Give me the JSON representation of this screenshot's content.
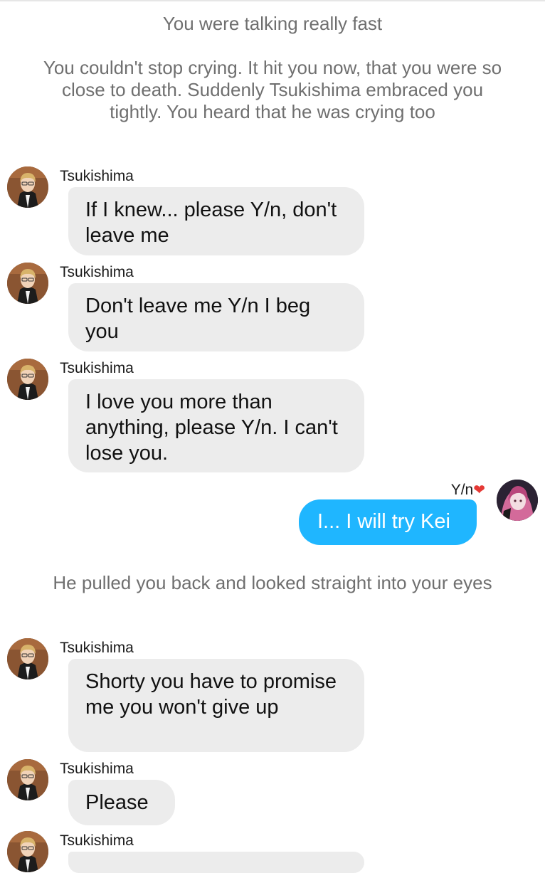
{
  "narration": [
    "You were talking really fast",
    "You couldn't stop crying. It hit you now, that you were so close to death. Suddenly Tsukishima embraced you tightly. You heard that he was crying too",
    "He pulled you back and looked straight into your eyes"
  ],
  "participants": {
    "other": {
      "name": "Tsukishima",
      "avatar_icon": "tsukishima-avatar-icon"
    },
    "me": {
      "name": "Y/n",
      "suffix_emoji": "❤",
      "avatar_icon": "user-avatar-icon"
    }
  },
  "messages": [
    {
      "sender": "Tsukishima",
      "text": "If I knew... please Y/n, don't leave me"
    },
    {
      "sender": "Tsukishima",
      "text": "Don't leave me Y/n I beg you"
    },
    {
      "sender": "Tsukishima",
      "text": "I love you more than anything, please Y/n. I can't lose you."
    },
    {
      "sender": "Y/n",
      "text": "I... I will try Kei"
    },
    {
      "sender": "Tsukishima",
      "text": "Shorty you have to promise me you won't give up"
    },
    {
      "sender": "Tsukishima",
      "text": "Please"
    },
    {
      "sender": "Tsukishima",
      "text": ""
    }
  ],
  "colors": {
    "incoming_bubble": "#ececec",
    "outgoing_bubble": "#1fb6ff",
    "narration_text": "#6f6f6f",
    "heart": "#e53935"
  }
}
